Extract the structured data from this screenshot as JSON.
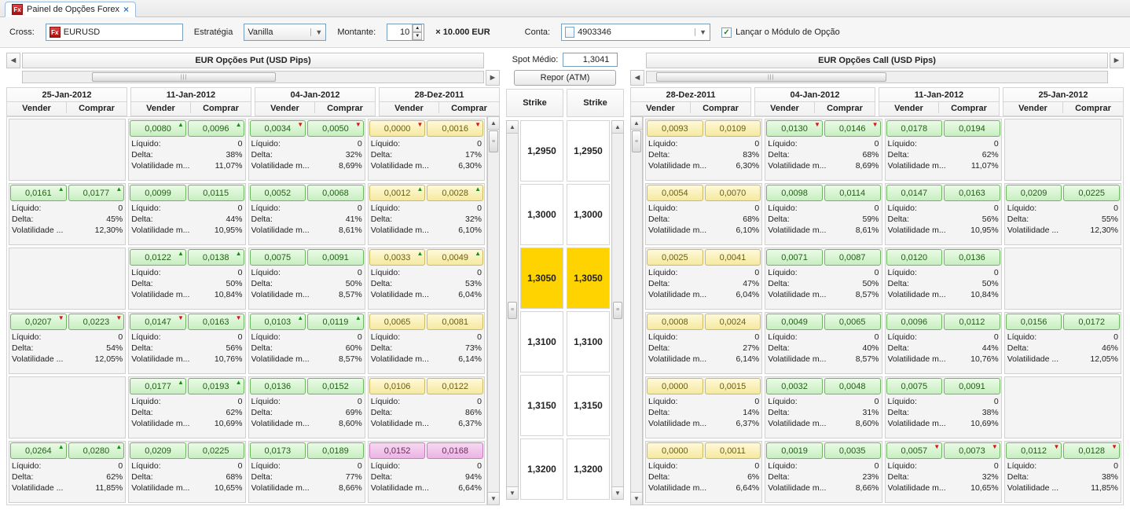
{
  "tab": {
    "title": "Painel de Opções Forex"
  },
  "controls": {
    "cross_label": "Cross:",
    "cross_value": "EURUSD",
    "strategy_label": "Estratégia",
    "strategy_value": "Vanilla",
    "amount_label": "Montante:",
    "amount_value": "10",
    "amount_mult": "× 10.000 EUR",
    "account_label": "Conta:",
    "account_value": "4903346",
    "launch_label": "Lançar o Módulo de Opção"
  },
  "mid": {
    "spot_label": "Spot Médio:",
    "spot_value": "1,3041",
    "repor_label": "Repor (ATM)",
    "strike_header": "Strike",
    "strikes": [
      "1,2950",
      "1,3000",
      "1,3050",
      "1,3100",
      "1,3150",
      "1,3200"
    ],
    "atm_index": 2
  },
  "labels": {
    "sell": "Vender",
    "buy": "Comprar",
    "liquid": "Líquido:",
    "delta": "Delta:",
    "volat": "Volatilidade ...",
    "volat_m": "Volatilidade m..."
  },
  "put": {
    "title": "EUR Opções Put (USD Pips)",
    "dates": [
      "25-Jan-2012",
      "11-Jan-2012",
      "04-Jan-2012",
      "28-Dez-2011"
    ],
    "rows": [
      [
        null,
        {
          "s": "0,0080",
          "b": "0,0096",
          "liq": "0",
          "d": "38%",
          "v": "11,07%",
          "c": "green",
          "arr": "up"
        },
        {
          "s": "0,0034",
          "b": "0,0050",
          "liq": "0",
          "d": "32%",
          "v": "8,69%",
          "c": "green",
          "arr": "down"
        },
        {
          "s": "0,0000",
          "b": "0,0016",
          "liq": "0",
          "d": "17%",
          "v": "6,30%",
          "c": "yellow",
          "arr": "down"
        }
      ],
      [
        {
          "s": "0,0161",
          "b": "0,0177",
          "liq": "0",
          "d": "45%",
          "v": "12,30%",
          "c": "green",
          "arr": "up"
        },
        {
          "s": "0,0099",
          "b": "0,0115",
          "liq": "0",
          "d": "44%",
          "v": "10,95%",
          "c": "green"
        },
        {
          "s": "0,0052",
          "b": "0,0068",
          "liq": "0",
          "d": "41%",
          "v": "8,61%",
          "c": "green"
        },
        {
          "s": "0,0012",
          "b": "0,0028",
          "liq": "0",
          "d": "32%",
          "v": "6,10%",
          "c": "yellow",
          "arr": "up"
        }
      ],
      [
        null,
        {
          "s": "0,0122",
          "b": "0,0138",
          "liq": "0",
          "d": "50%",
          "v": "10,84%",
          "c": "green",
          "arr": "up"
        },
        {
          "s": "0,0075",
          "b": "0,0091",
          "liq": "0",
          "d": "50%",
          "v": "8,57%",
          "c": "green"
        },
        {
          "s": "0,0033",
          "b": "0,0049",
          "liq": "0",
          "d": "53%",
          "v": "6,04%",
          "c": "yellow",
          "arr": "up"
        }
      ],
      [
        {
          "s": "0,0207",
          "b": "0,0223",
          "liq": "0",
          "d": "54%",
          "v": "12,05%",
          "c": "green",
          "arr": "down"
        },
        {
          "s": "0,0147",
          "b": "0,0163",
          "liq": "0",
          "d": "56%",
          "v": "10,76%",
          "c": "green",
          "arr": "down"
        },
        {
          "s": "0,0103",
          "b": "0,0119",
          "liq": "0",
          "d": "60%",
          "v": "8,57%",
          "c": "green",
          "arr": "up"
        },
        {
          "s": "0,0065",
          "b": "0,0081",
          "liq": "0",
          "d": "73%",
          "v": "6,14%",
          "c": "yellow"
        }
      ],
      [
        null,
        {
          "s": "0,0177",
          "b": "0,0193",
          "liq": "0",
          "d": "62%",
          "v": "10,69%",
          "c": "green",
          "arr": "up"
        },
        {
          "s": "0,0136",
          "b": "0,0152",
          "liq": "0",
          "d": "69%",
          "v": "8,60%",
          "c": "green"
        },
        {
          "s": "0,0106",
          "b": "0,0122",
          "liq": "0",
          "d": "86%",
          "v": "6,37%",
          "c": "yellow"
        }
      ],
      [
        {
          "s": "0,0264",
          "b": "0,0280",
          "liq": "0",
          "d": "62%",
          "v": "11,85%",
          "c": "green",
          "arr": "up"
        },
        {
          "s": "0,0209",
          "b": "0,0225",
          "liq": "0",
          "d": "68%",
          "v": "10,65%",
          "c": "green"
        },
        {
          "s": "0,0173",
          "b": "0,0189",
          "liq": "0",
          "d": "77%",
          "v": "8,66%",
          "c": "green"
        },
        {
          "s": "0,0152",
          "b": "0,0168",
          "liq": "0",
          "d": "94%",
          "v": "6,64%",
          "c": "pink"
        }
      ]
    ]
  },
  "call": {
    "title": "EUR Opções Call (USD Pips)",
    "dates": [
      "28-Dez-2011",
      "04-Jan-2012",
      "11-Jan-2012",
      "25-Jan-2012"
    ],
    "rows": [
      [
        {
          "s": "0,0093",
          "b": "0,0109",
          "liq": "0",
          "d": "83%",
          "v": "6,30%",
          "c": "yellow"
        },
        {
          "s": "0,0130",
          "b": "0,0146",
          "liq": "0",
          "d": "68%",
          "v": "8,69%",
          "c": "green",
          "arr": "down"
        },
        {
          "s": "0,0178",
          "b": "0,0194",
          "liq": "0",
          "d": "62%",
          "v": "11,07%",
          "c": "green"
        },
        null
      ],
      [
        {
          "s": "0,0054",
          "b": "0,0070",
          "liq": "0",
          "d": "68%",
          "v": "6,10%",
          "c": "yellow"
        },
        {
          "s": "0,0098",
          "b": "0,0114",
          "liq": "0",
          "d": "59%",
          "v": "8,61%",
          "c": "green"
        },
        {
          "s": "0,0147",
          "b": "0,0163",
          "liq": "0",
          "d": "56%",
          "v": "10,95%",
          "c": "green"
        },
        {
          "s": "0,0209",
          "b": "0,0225",
          "liq": "0",
          "d": "55%",
          "v": "12,30%",
          "c": "green"
        }
      ],
      [
        {
          "s": "0,0025",
          "b": "0,0041",
          "liq": "0",
          "d": "47%",
          "v": "6,04%",
          "c": "yellow"
        },
        {
          "s": "0,0071",
          "b": "0,0087",
          "liq": "0",
          "d": "50%",
          "v": "8,57%",
          "c": "green"
        },
        {
          "s": "0,0120",
          "b": "0,0136",
          "liq": "0",
          "d": "50%",
          "v": "10,84%",
          "c": "green"
        },
        null
      ],
      [
        {
          "s": "0,0008",
          "b": "0,0024",
          "liq": "0",
          "d": "27%",
          "v": "6,14%",
          "c": "yellow"
        },
        {
          "s": "0,0049",
          "b": "0,0065",
          "liq": "0",
          "d": "40%",
          "v": "8,57%",
          "c": "green"
        },
        {
          "s": "0,0096",
          "b": "0,0112",
          "liq": "0",
          "d": "44%",
          "v": "10,76%",
          "c": "green"
        },
        {
          "s": "0,0156",
          "b": "0,0172",
          "liq": "0",
          "d": "46%",
          "v": "12,05%",
          "c": "green"
        }
      ],
      [
        {
          "s": "0,0000",
          "b": "0,0015",
          "liq": "0",
          "d": "14%",
          "v": "6,37%",
          "c": "yellow"
        },
        {
          "s": "0,0032",
          "b": "0,0048",
          "liq": "0",
          "d": "31%",
          "v": "8,60%",
          "c": "green"
        },
        {
          "s": "0,0075",
          "b": "0,0091",
          "liq": "0",
          "d": "38%",
          "v": "10,69%",
          "c": "green"
        },
        null
      ],
      [
        {
          "s": "0,0000",
          "b": "0,0011",
          "liq": "0",
          "d": "6%",
          "v": "6,64%",
          "c": "yellow"
        },
        {
          "s": "0,0019",
          "b": "0,0035",
          "liq": "0",
          "d": "23%",
          "v": "8,66%",
          "c": "green"
        },
        {
          "s": "0,0057",
          "b": "0,0073",
          "liq": "0",
          "d": "32%",
          "v": "10,65%",
          "c": "green",
          "arr": "down"
        },
        {
          "s": "0,0112",
          "b": "0,0128",
          "liq": "0",
          "d": "38%",
          "v": "11,85%",
          "c": "green",
          "arr": "down"
        }
      ]
    ]
  }
}
